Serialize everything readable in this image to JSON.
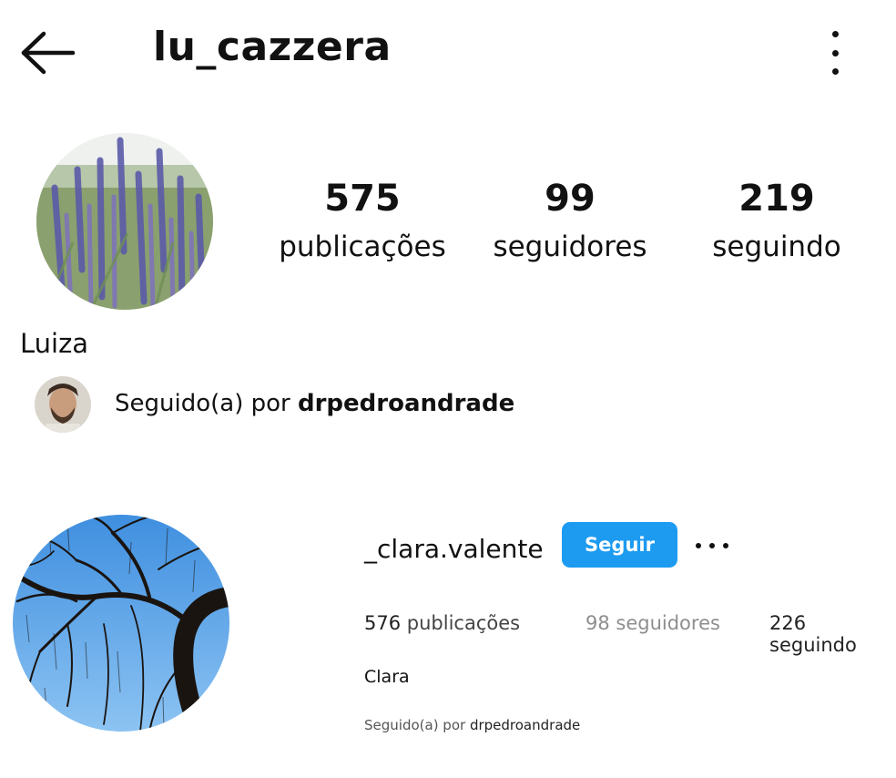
{
  "header": {
    "username": "lu_cazzera",
    "back_icon": "arrow-left-icon",
    "menu_icon": "vertical-dots-icon"
  },
  "profile": {
    "stats": {
      "posts": {
        "count": "575",
        "label": "publicações"
      },
      "followers": {
        "count": "99",
        "label": "seguidores"
      },
      "following": {
        "count": "219",
        "label": "seguindo"
      }
    },
    "display_name": "Luiza",
    "followed_by": {
      "prefix": "Seguido(a) por ",
      "user": "drpedroandrade"
    }
  },
  "profile2": {
    "username": "_clara.valente",
    "follow_button": "Seguir",
    "more_icon": "horizontal-dots-icon",
    "stats": {
      "posts": {
        "count": "576",
        "label": "publicações"
      },
      "followers": "98 seguidores",
      "following": "226 seguindo"
    },
    "display_name": "Clara",
    "followed_by": {
      "prefix": "Seguido(a) por ",
      "user": "drpedroandrade"
    }
  },
  "colors": {
    "follow_button": "#1d9bf0",
    "muted_text": "#8e8e8e"
  }
}
